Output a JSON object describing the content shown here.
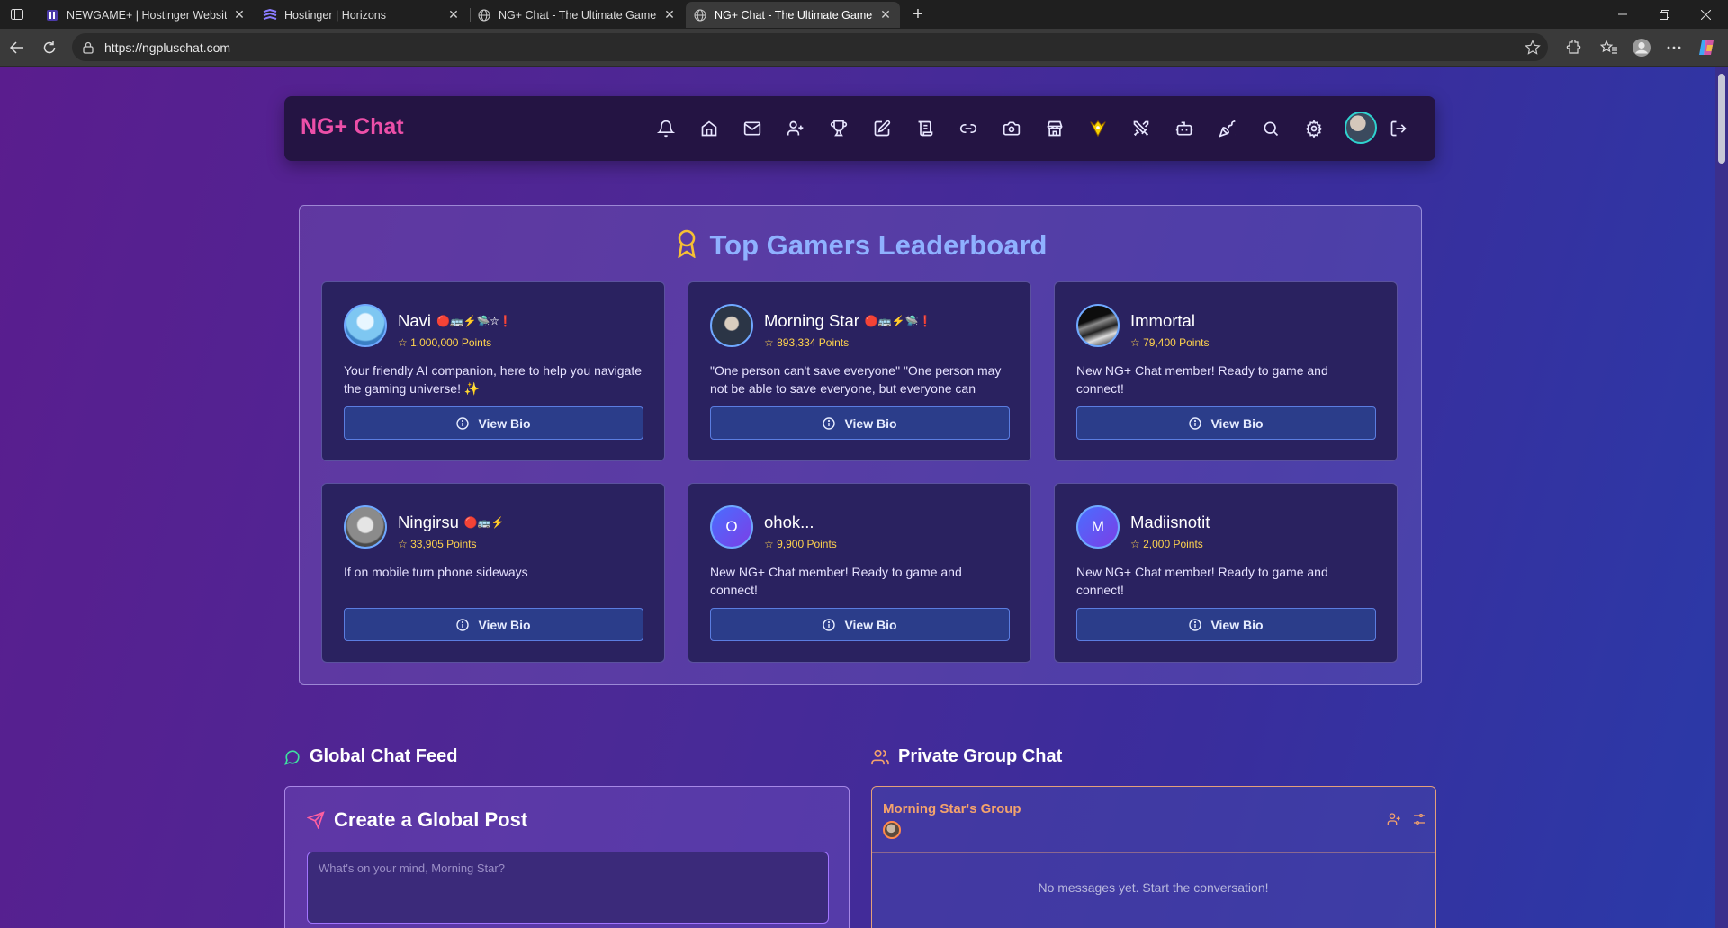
{
  "browser": {
    "tabs": [
      {
        "title": "NEWGAME+ | Hostinger Website",
        "favicon": "hostinger-icon",
        "active": false
      },
      {
        "title": "Hostinger | Horizons",
        "favicon": "horizons-icon",
        "active": false
      },
      {
        "title": "NG+ Chat - The Ultimate Gamer Hub",
        "favicon": "globe-icon",
        "active": false
      },
      {
        "title": "NG+ Chat - The Ultimate Gamer Hub",
        "favicon": "globe-icon",
        "active": true
      }
    ],
    "url": "https://ngpluschat.com"
  },
  "app": {
    "brand": "NG+ Chat",
    "nav_icons": [
      "bell-icon",
      "home-icon",
      "mail-icon",
      "user-plus-icon",
      "trophy-icon",
      "edit-icon",
      "scroll-icon",
      "link-icon",
      "camera-icon",
      "store-icon",
      "sparkle-badge-icon",
      "swords-icon",
      "bot-icon",
      "party-icon",
      "search-icon",
      "settings-icon",
      "avatar",
      "logout-icon"
    ]
  },
  "leaderboard": {
    "title": "Top Gamers Leaderboard",
    "view_bio_label": "View Bio",
    "players": [
      {
        "name": "Navi",
        "badges": "🔴🚌⚡🛸⛦❗",
        "points": "1,000,000 Points",
        "bio": "Your friendly AI companion, here to help you navigate the gaming universe! ✨"
      },
      {
        "name": "Morning Star",
        "badges": "🔴🚌⚡🛸❗",
        "points": "893,334 Points",
        "bio": "\"One person can't save everyone\" \"One person may not be able to save everyone, but everyone can save..."
      },
      {
        "name": "Immortal",
        "badges": "",
        "points": "79,400 Points",
        "bio": "New NG+ Chat member! Ready to game and connect!"
      },
      {
        "name": "Ningirsu",
        "badges": "🔴🚌⚡",
        "points": "33,905 Points",
        "bio": "If on mobile turn phone sideways"
      },
      {
        "name": "ohok...",
        "badges": "",
        "points": "9,900 Points",
        "bio": "New NG+ Chat member! Ready to game and connect!",
        "initial": "O"
      },
      {
        "name": "Madiisnotit",
        "badges": "",
        "points": "2,000 Points",
        "bio": "New NG+ Chat member! Ready to game and connect!",
        "initial": "M"
      }
    ]
  },
  "global_feed": {
    "heading": "Global Chat Feed",
    "create_title": "Create a Global Post",
    "placeholder": "What's on your mind, Morning Star?"
  },
  "group_chat": {
    "heading": "Private Group Chat",
    "group_name": "Morning Star's Group",
    "empty": "No messages yet. Start the conversation!"
  },
  "colors": {
    "brand": "#ec4fa8",
    "leaderboard_title": "#8fb1ff",
    "points": "#ffd34d",
    "group_accent": "#f4a36c"
  }
}
